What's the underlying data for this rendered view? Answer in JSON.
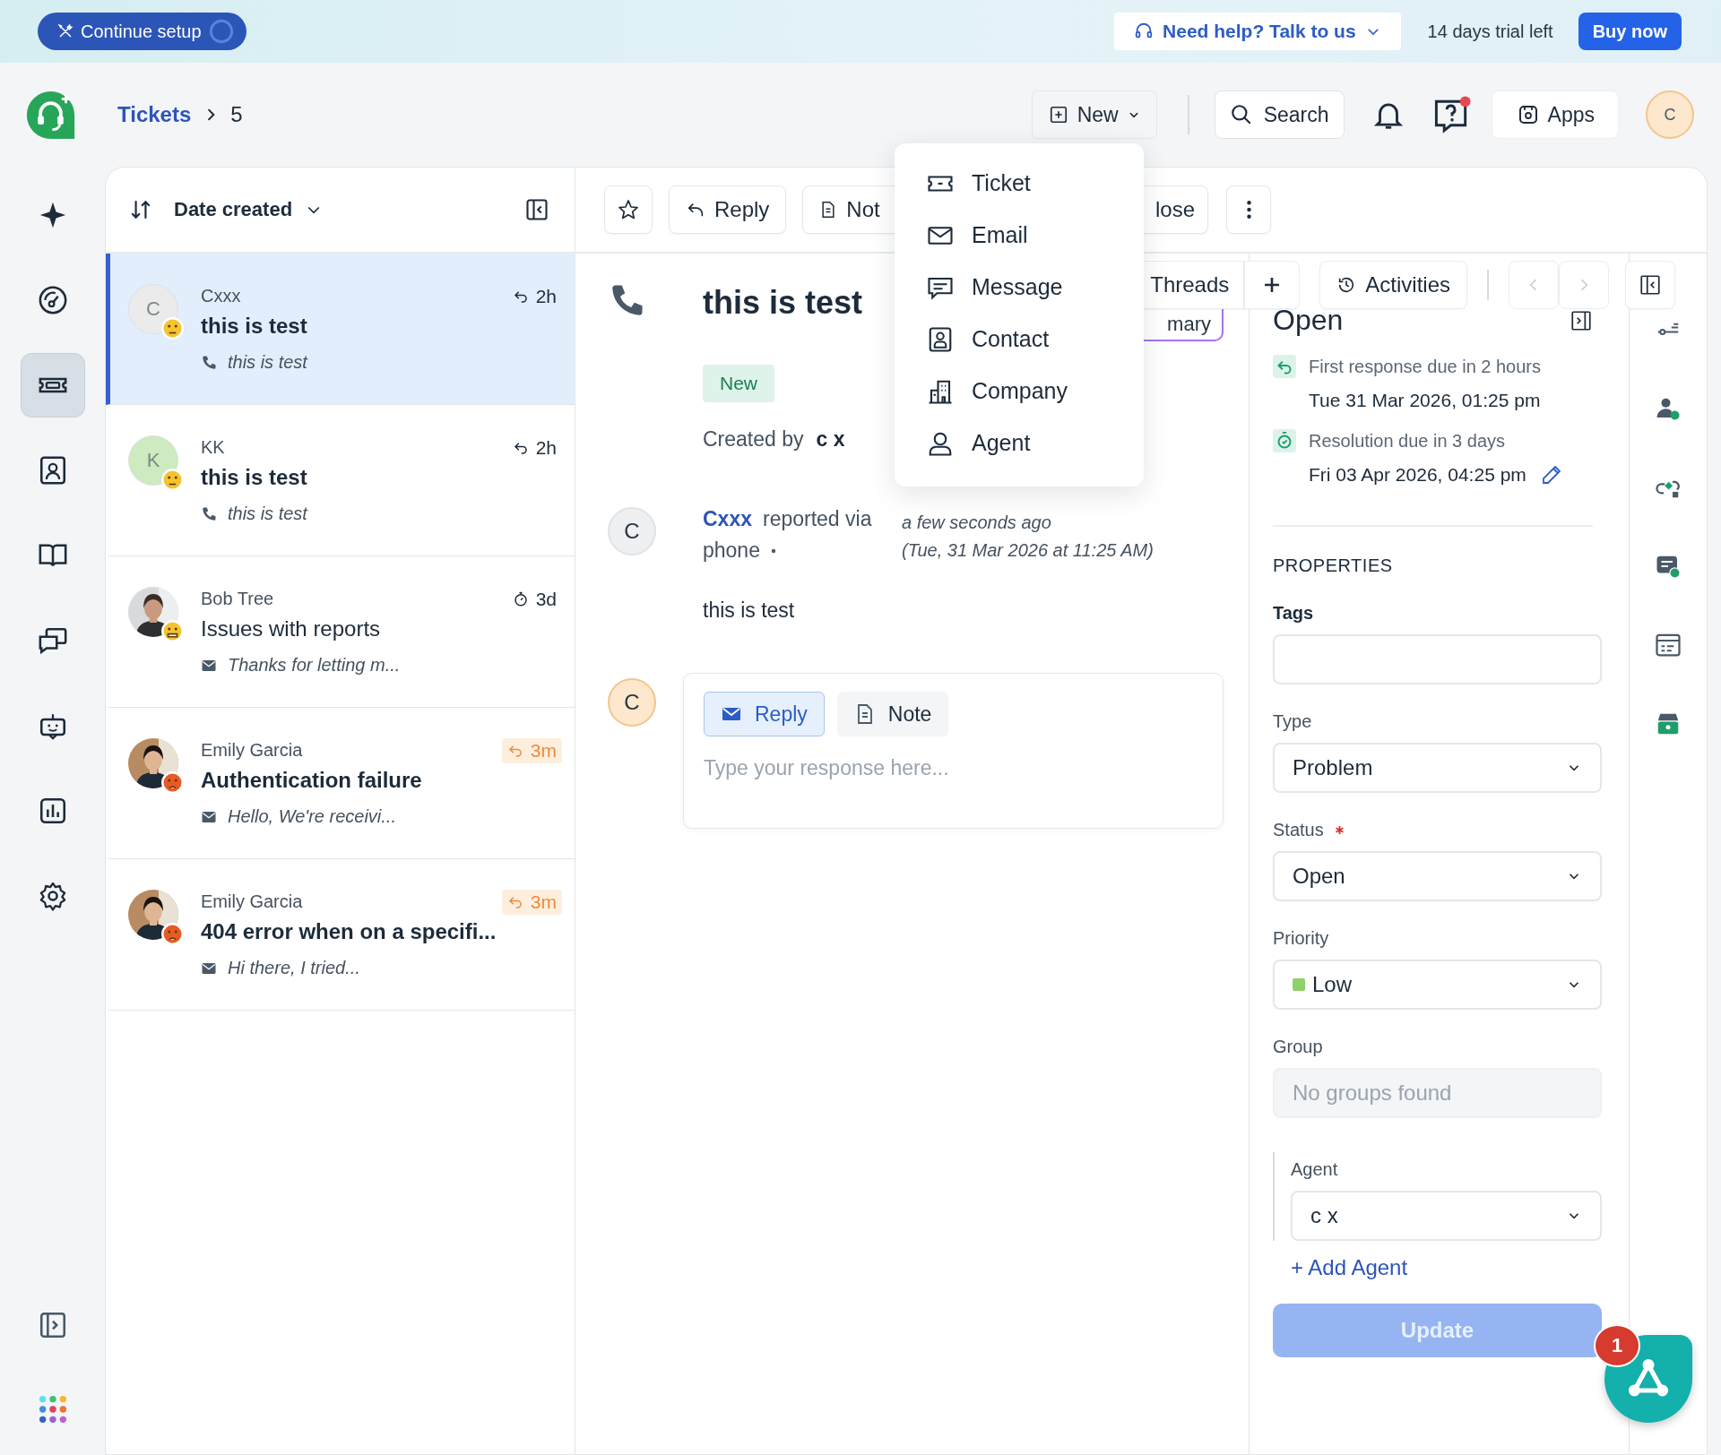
{
  "banner": {
    "setup": "Continue setup",
    "help": "Need help? Talk to us",
    "trial": "14 days trial left",
    "buy": "Buy now"
  },
  "header": {
    "breadcrumb": "Tickets",
    "ticket_number": "5",
    "new": "New",
    "search": "Search",
    "help_unread": true,
    "apps": "Apps",
    "avatar": "C"
  },
  "nav": [
    {
      "selected": false
    },
    {
      "selected": false
    },
    {
      "selected": true
    },
    {
      "selected": false
    },
    {
      "selected": false
    },
    {
      "selected": false
    },
    {
      "selected": false
    },
    {
      "selected": false
    },
    {
      "selected": false
    }
  ],
  "ticket_list": {
    "sort": "Date created",
    "tickets": [
      {
        "avatar": {
          "kind": "initial",
          "letter": "C",
          "color": "#ebebeb"
        },
        "mood": {
          "kind": "neutral"
        },
        "name": "Cxxx",
        "subject": "this is test",
        "unread": true,
        "channel": {
          "kind": "phone"
        },
        "preview": "this is test",
        "sla": {
          "kind": "reply"
        },
        "time": "2h",
        "overdue": false,
        "selected": true
      },
      {
        "avatar": {
          "kind": "initial",
          "letter": "K",
          "color": "#cdeac0"
        },
        "mood": {
          "kind": "neutral"
        },
        "name": "KK",
        "subject": "this is test",
        "unread": true,
        "channel": {
          "kind": "phone"
        },
        "preview": "this is test",
        "sla": {
          "kind": "reply"
        },
        "time": "2h",
        "overdue": false,
        "selected": false
      },
      {
        "mood": {
          "kind": "grin"
        },
        "name": "Bob Tree",
        "subject": "Issues with reports",
        "unread": false,
        "channel": {
          "kind": "email"
        },
        "preview": "Thanks for letting m...",
        "sla": {
          "kind": "timer"
        },
        "time": "3d",
        "overdue": false,
        "selected": false
      },
      {
        "mood": {
          "kind": "angry"
        },
        "name": "Emily Garcia",
        "subject": "Authentication failure",
        "unread": true,
        "channel": {
          "kind": "email"
        },
        "preview": "Hello, We're receivi...",
        "sla": {
          "kind": "reply"
        },
        "time": "3m",
        "overdue": true,
        "selected": false
      },
      {
        "mood": {
          "kind": "angry"
        },
        "name": "Emily Garcia",
        "subject": "404 error when on a specifi...",
        "unread": true,
        "channel": {
          "kind": "email"
        },
        "preview": "Hi there, I tried...",
        "sla": {
          "kind": "reply"
        },
        "time": "3m",
        "overdue": true,
        "selected": false
      }
    ]
  },
  "toolbar": {
    "reply": "Reply",
    "note": "Not",
    "close": "lose"
  },
  "ticket": {
    "title": "this is test",
    "status": "New",
    "summary": "mary",
    "created_label": "Created by",
    "created_by": "c x"
  },
  "message": {
    "avatar": "C",
    "author": "Cxxx",
    "via": "reported via",
    "channel": "phone",
    "time": "a few seconds ago",
    "timestamp": "(Tue, 31 Mar 2026 at 11:25 AM)",
    "body": "this is test"
  },
  "composer": {
    "avatar": "C",
    "tabs": [
      {
        "label": "Reply",
        "selected": true
      },
      {
        "label": "Note",
        "selected": false
      }
    ],
    "placeholder": "Type your response here..."
  },
  "new_menu": [
    "Ticket",
    "Email",
    "Message",
    "Contact",
    "Company",
    "Agent"
  ],
  "side_tabs": {
    "threads": "Threads",
    "activities": "Activities"
  },
  "properties": {
    "status_heading": "Open",
    "sla": [
      {
        "kind": "reply",
        "label": "First response due in 2 hours",
        "due": "Tue 31 Mar 2026, 01:25 pm",
        "editable": false
      },
      {
        "kind": "timer",
        "label": "Resolution due in 3 days",
        "due": "Fri 03 Apr 2026, 04:25 pm",
        "editable": true
      }
    ],
    "section": "PROPERTIES",
    "fields": [
      {
        "label": "Tags",
        "kind": "tags",
        "required": false
      },
      {
        "label": "Type",
        "kind": "select",
        "value": "Problem",
        "required": false
      },
      {
        "label": "Status",
        "kind": "select",
        "value": "Open",
        "required": true
      },
      {
        "label": "Priority",
        "kind": "select",
        "value": "Low",
        "color": "#8cd169",
        "required": false
      },
      {
        "label": "Group",
        "kind": "readonly",
        "placeholder": "No groups found",
        "required": false
      },
      {
        "label": "Agent",
        "kind": "assignee",
        "value": "c x",
        "required": false
      }
    ],
    "add_agent": "+ Add Agent",
    "update": "Update",
    "update_disabled": true
  },
  "chat_widget": {
    "badge": "1"
  }
}
